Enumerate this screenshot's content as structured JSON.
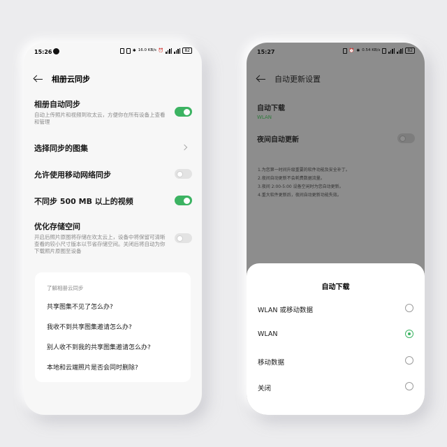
{
  "left_phone": {
    "status": {
      "time": "15:26",
      "speed": "16.0 KB/s",
      "battery": "82"
    },
    "title": "相册云同步",
    "settings": [
      {
        "title": "相册自动同步",
        "subtitle": "自动上传照片和视频到欢太云，方便你在所有设备上查看和管理",
        "toggle": "on"
      },
      {
        "title": "选择同步的图集",
        "chevron": true
      },
      {
        "title": "允许使用移动网络同步",
        "toggle": "off"
      },
      {
        "title": "不同步 500 MB 以上的视频",
        "toggle": "on"
      },
      {
        "title": "优化存储空间",
        "subtitle": "开启后照片原图将存储在欢太云上，设备中将保留可清晰查看的较小尺寸版本以节省存储空间。关闭后将自动为你下载照片原图至设备",
        "toggle": "off"
      }
    ],
    "faq": {
      "heading": "了解相册云同步",
      "items": [
        "共享图集不见了怎么办?",
        "我收不到共享图集邀请怎么办?",
        "别人收不到我的共享图集邀请怎么办?",
        "本地和云端照片是否会同时删除?"
      ]
    }
  },
  "right_phone": {
    "status": {
      "time": "15:27",
      "speed": "0.54 KB/s",
      "battery": "82"
    },
    "title": "自动更新设置",
    "auto_download": {
      "title": "自动下载",
      "value": "WLAN"
    },
    "night_update": {
      "title": "夜间自动更新",
      "toggle": "off"
    },
    "notes": [
      "1.为您第一时间升级重要的软件功能及安全补丁。",
      "2.夜间自动更新不会耗费数据流量。",
      "3.夜间 2:00-5:00 设备空闲时为您自动更新。",
      "4.重大软件更新后，夜间自动更新功能失效。"
    ],
    "sheet": {
      "title": "自动下载",
      "options": [
        {
          "label": "WLAN 或移动数据",
          "selected": false
        },
        {
          "label": "WLAN",
          "selected": true
        },
        {
          "label": "移动数据",
          "selected": false
        },
        {
          "label": "关闭",
          "selected": false
        }
      ]
    }
  },
  "colors": {
    "accent": "#3cb362",
    "page_bg": "#ececee",
    "dim_overlay": "#8d8d8d"
  }
}
